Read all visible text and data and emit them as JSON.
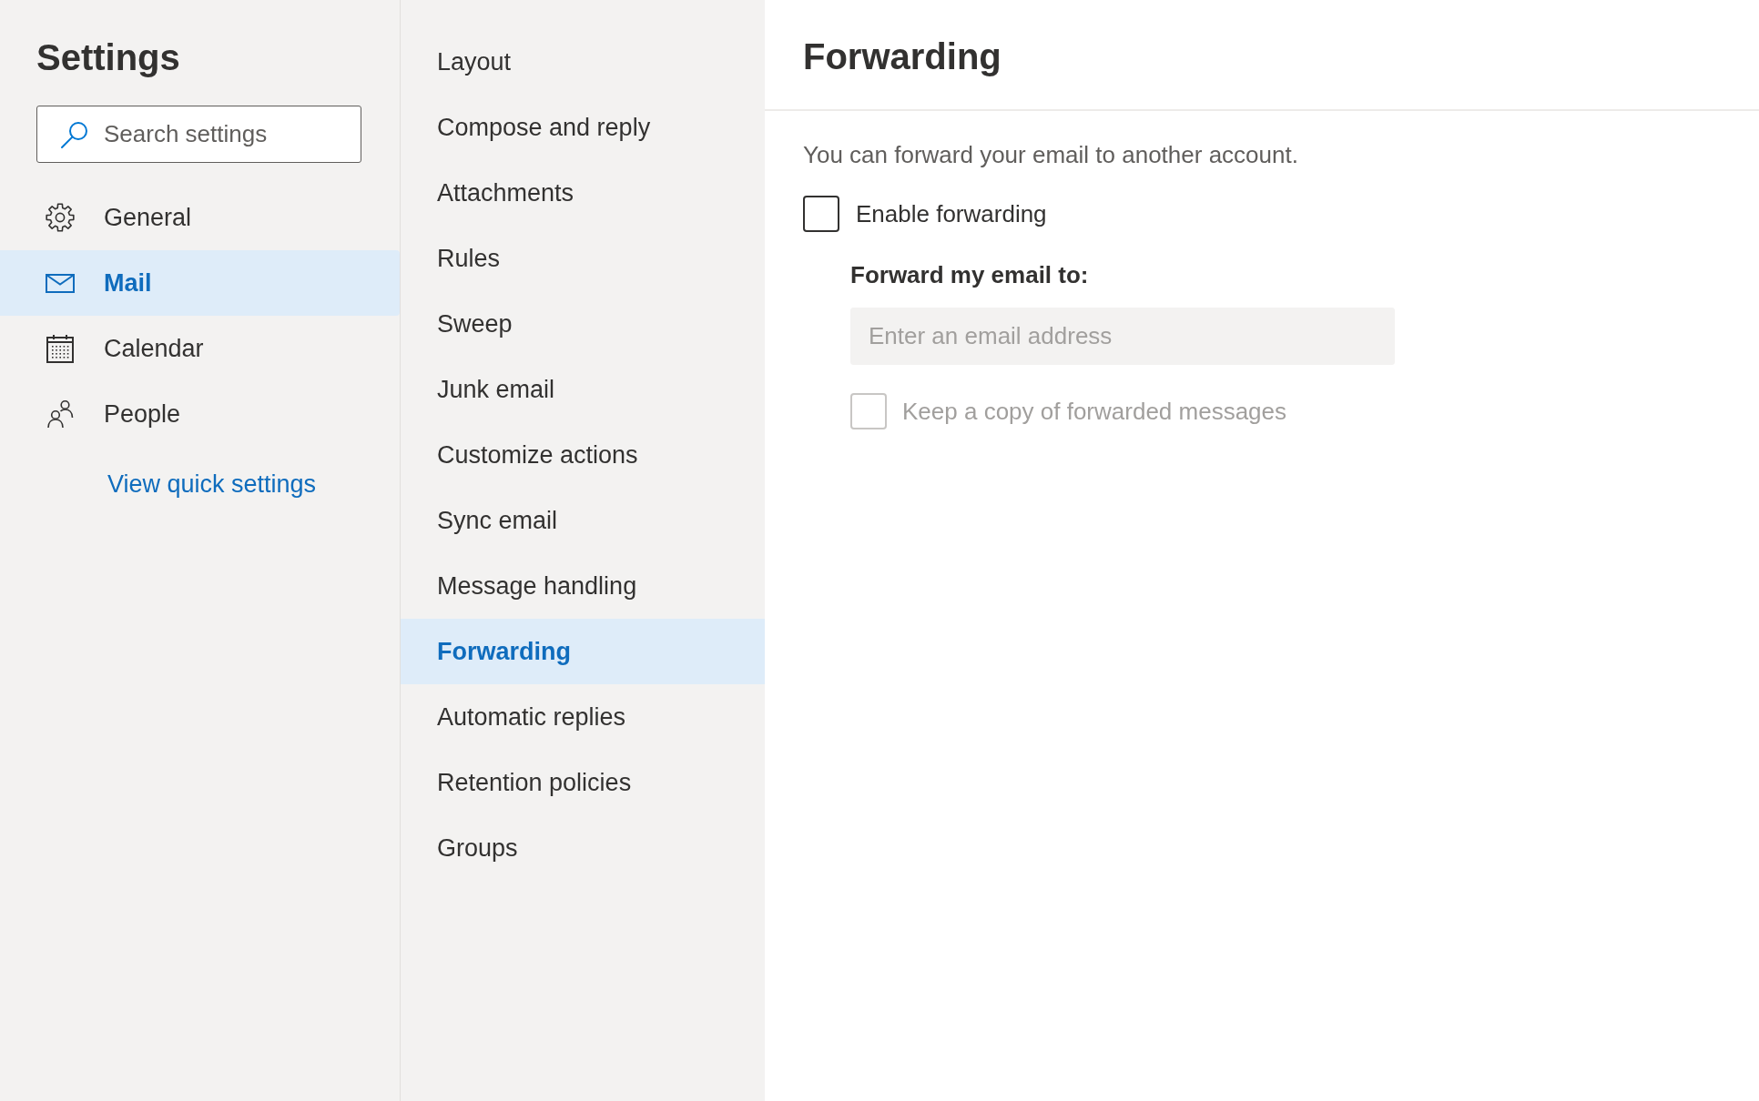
{
  "sidebar": {
    "title": "Settings",
    "search": {
      "placeholder": "Search settings"
    },
    "items": [
      {
        "label": "General",
        "selected": false
      },
      {
        "label": "Mail",
        "selected": true
      },
      {
        "label": "Calendar",
        "selected": false
      },
      {
        "label": "People",
        "selected": false
      }
    ],
    "link": "View quick settings"
  },
  "submenu": {
    "items": [
      {
        "label": "Layout",
        "selected": false
      },
      {
        "label": "Compose and reply",
        "selected": false
      },
      {
        "label": "Attachments",
        "selected": false
      },
      {
        "label": "Rules",
        "selected": false
      },
      {
        "label": "Sweep",
        "selected": false
      },
      {
        "label": "Junk email",
        "selected": false
      },
      {
        "label": "Customize actions",
        "selected": false
      },
      {
        "label": "Sync email",
        "selected": false
      },
      {
        "label": "Message handling",
        "selected": false
      },
      {
        "label": "Forwarding",
        "selected": true
      },
      {
        "label": "Automatic replies",
        "selected": false
      },
      {
        "label": "Retention policies",
        "selected": false
      },
      {
        "label": "Groups",
        "selected": false
      }
    ]
  },
  "panel": {
    "title": "Forwarding",
    "description": "You can forward your email to another account.",
    "enable_forwarding": {
      "label": "Enable forwarding",
      "checked": false,
      "disabled": false
    },
    "forward_to": {
      "label": "Forward my email to:",
      "placeholder": "Enter an email address",
      "disabled": true
    },
    "keep_copy": {
      "label": "Keep a copy of forwarded messages",
      "checked": false,
      "disabled": true
    }
  }
}
